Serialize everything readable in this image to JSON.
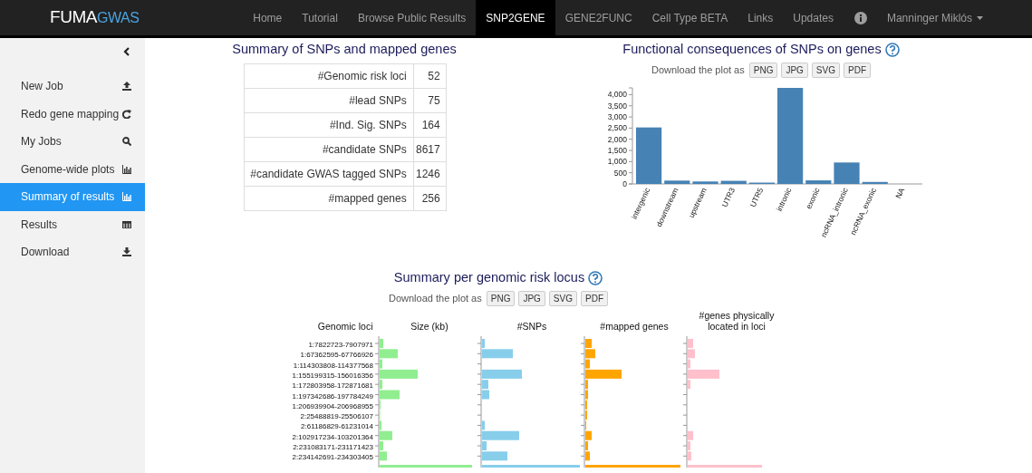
{
  "navbar": {
    "logo": {
      "main": "FUMA",
      "accent": "GWAS"
    },
    "items": [
      {
        "label": "Home",
        "selected": false
      },
      {
        "label": "Tutorial",
        "selected": false
      },
      {
        "label": "Browse Public Results",
        "selected": false
      },
      {
        "label": "SNP2GENE",
        "selected": true
      },
      {
        "label": "GENE2FUNC",
        "selected": false
      },
      {
        "label": "Cell Type BETA",
        "selected": false
      },
      {
        "label": "Links",
        "selected": false
      },
      {
        "label": "Updates",
        "selected": false
      }
    ],
    "user": "Manninger Miklós"
  },
  "sidebar": {
    "items": [
      {
        "label": "New Job",
        "selected": false
      },
      {
        "label": "Redo gene mapping",
        "selected": false
      },
      {
        "label": "My Jobs",
        "selected": false
      },
      {
        "label": "Genome-wide plots",
        "selected": false
      },
      {
        "label": "Summary of results",
        "selected": true
      },
      {
        "label": "Results",
        "selected": false
      },
      {
        "label": "Download",
        "selected": false
      }
    ]
  },
  "summary": {
    "title": "Summary of SNPs and mapped genes",
    "rows": [
      {
        "label": "#Genomic risk loci",
        "value": "52"
      },
      {
        "label": "#lead SNPs",
        "value": "75"
      },
      {
        "label": "#Ind. Sig. SNPs",
        "value": "164"
      },
      {
        "label": "#candidate SNPs",
        "value": "8617"
      },
      {
        "label": "#candidate GWAS tagged SNPs",
        "value": "1246"
      },
      {
        "label": "#mapped genes",
        "value": "256"
      }
    ]
  },
  "functional": {
    "title": "Functional consequences of SNPs on genes",
    "download_label": "Download the plot as",
    "formats": [
      "PNG",
      "JPG",
      "SVG",
      "PDF"
    ],
    "chart_data": {
      "type": "bar",
      "categories": [
        "intergenic",
        "downstream",
        "upstream",
        "UTR3",
        "UTR5",
        "intronic",
        "exonic",
        "ncRNA_intronic",
        "ncRNA_exonic",
        "NA"
      ],
      "values": [
        2530,
        150,
        110,
        140,
        60,
        4300,
        160,
        960,
        90,
        0
      ],
      "ylim": [
        0,
        4300
      ],
      "yticks": [
        {
          "value": 0,
          "label": "0"
        },
        {
          "value": 500,
          "label": "500"
        },
        {
          "value": 1000,
          "label": "1,000"
        },
        {
          "value": 1500,
          "label": "1,500"
        },
        {
          "value": 2000,
          "label": "2,000"
        },
        {
          "value": 2500,
          "label": "2,500"
        },
        {
          "value": 3000,
          "label": "3,000"
        },
        {
          "value": 3500,
          "label": "3,500"
        },
        {
          "value": 4000,
          "label": "4,000"
        }
      ]
    }
  },
  "locus": {
    "title": "Summary per genomic risk locus",
    "download_label": "Download the plot as",
    "formats": [
      "PNG",
      "JPG",
      "SVG",
      "PDF"
    ],
    "row_header": "Genomic loci",
    "columns": [
      {
        "label": "Size (kb)",
        "color": "#90ee90"
      },
      {
        "label": "#SNPs",
        "color": "#87ceeb"
      },
      {
        "label": "#mapped genes",
        "color": "#ffa500"
      },
      {
        "label": "#genes physically located in loci",
        "color": "#ffc0cb"
      }
    ],
    "loci": [
      "1:7822723-7907971",
      "1:67362595-67766926",
      "1:114303808-114377568",
      "1:155199315-156016356",
      "1:172803958-172871681",
      "1:197342686-197784249",
      "1:206939904-206968955",
      "2:25488819-25506107",
      "2:61186829-61231014",
      "2:102917234-103201364",
      "2:231083171-231171423",
      "2:234142691-234303405"
    ]
  }
}
